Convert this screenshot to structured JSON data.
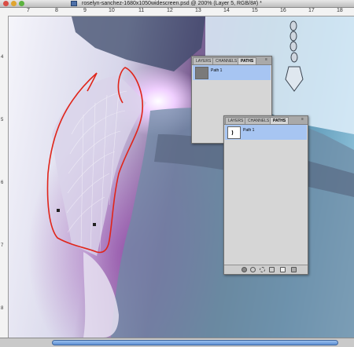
{
  "window": {
    "title": "roselyn-sanchez-1680x1050widescreen.psd @ 200% (Layer 5, RGB/8#) *"
  },
  "ruler": {
    "labels": [
      "7",
      "8",
      "9",
      "10",
      "11",
      "12",
      "13",
      "14",
      "15",
      "16",
      "17",
      "18"
    ]
  },
  "panels": {
    "back": {
      "tabs": [
        "LAYERS",
        "CHANNELS",
        "PATHS"
      ],
      "active_tab": "PATHS",
      "path_name": "Path 1"
    },
    "front": {
      "tabs": [
        "LAYERS",
        "CHANNELS",
        "PATHS"
      ],
      "active_tab": "PATHS",
      "path_name": "Path 1"
    }
  },
  "icons": [
    "close-icon",
    "minimize-icon",
    "zoom-icon",
    "document-icon",
    "panel-menu-icon",
    "path-thumbnail-icon",
    "fill-path-icon",
    "stroke-path-icon",
    "load-selection-icon",
    "make-path-icon",
    "new-path-icon",
    "delete-path-icon"
  ],
  "colors": {
    "selected_row": "#a7c5f2",
    "annotation_red": "#e0251a",
    "scrollbar_blue": "#5d8fd4"
  }
}
